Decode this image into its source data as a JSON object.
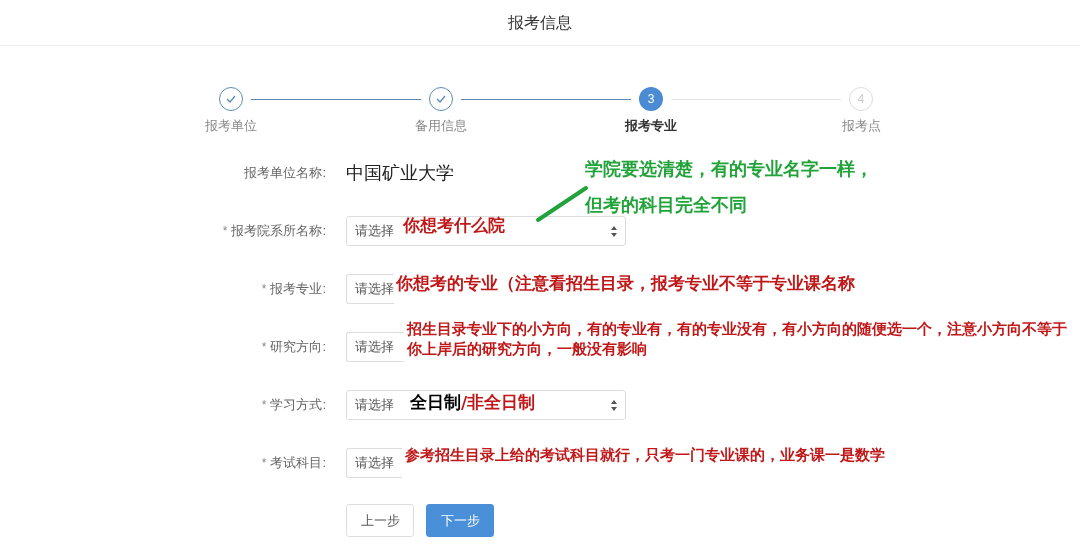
{
  "header": {
    "title": "报考信息"
  },
  "steps": [
    {
      "label": "报考单位",
      "completed": true,
      "selected": false
    },
    {
      "label": "备用信息",
      "completed": true,
      "selected": false
    },
    {
      "number": "3",
      "label": "报考专业",
      "completed": false,
      "selected": true
    },
    {
      "number": "4",
      "label": "报考点",
      "completed": false,
      "selected": false
    }
  ],
  "form": {
    "fields": [
      {
        "kind": "static",
        "label": "报考单位名称:",
        "value": "中国矿业大学"
      },
      {
        "kind": "select",
        "required_mark": "*",
        "label": "报考院系所名称:",
        "placeholder": "请选择",
        "annotation": [
          {
            "text": "你想考什么院",
            "color": "#c01818"
          }
        ]
      },
      {
        "kind": "select",
        "required_mark": "*",
        "label": "报考专业:",
        "placeholder": "请选择",
        "annotation": [
          {
            "text": "你想考的专业（注意看招生目录，报考专业不等于专业课名称",
            "color": "#c01818"
          }
        ]
      },
      {
        "kind": "select",
        "required_mark": "*",
        "label": "研究方向:",
        "placeholder": "请选择",
        "annotation": [
          {
            "text": "招生目录专业下的小方向，有的专业有，有的专业没有，有小方向的随便选一个，注意小方向不等于你上岸后的研究方向，一般没有影响",
            "color": "#c01818"
          }
        ]
      },
      {
        "kind": "select",
        "required_mark": "*",
        "label": "学习方式:",
        "placeholder": "请选择",
        "annotation": [
          {
            "text": "全日制",
            "color": "#000000"
          },
          {
            "text": "/非全日制",
            "color": "#c01818"
          }
        ]
      },
      {
        "kind": "select",
        "required_mark": "*",
        "label": "考试科目:",
        "placeholder": "请选择",
        "annotation": [
          {
            "text": "参考招生目录上给的考试科目就行，只考一门专业课的，业务课一是数学",
            "color": "#c01818"
          }
        ]
      }
    ],
    "buttons": [
      {
        "label": "上一步",
        "kind": "secondary"
      },
      {
        "label": "下一步",
        "kind": "primary"
      }
    ]
  },
  "note": {
    "lines": [
      "学院要选清楚，有的专业名字一样，",
      "但考的科目完全不同"
    ]
  }
}
